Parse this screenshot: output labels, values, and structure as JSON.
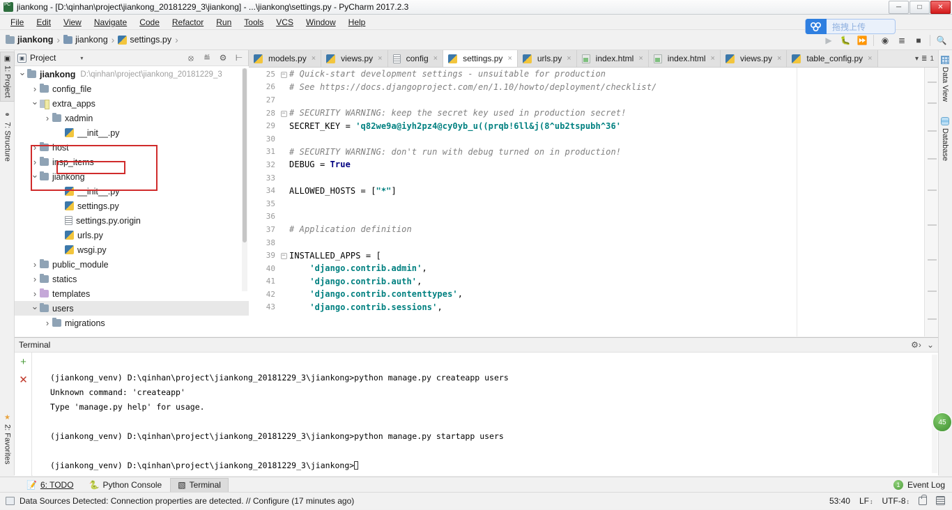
{
  "window": {
    "title": "jiankong - [D:\\qinhan\\project\\jiankong_20181229_3\\jiankong] - ...\\jiankong\\settings.py - PyCharm 2017.2.3",
    "minimize": "─",
    "maximize": "□",
    "close": "✕",
    "app_icon": "pycharm-icon"
  },
  "menu": {
    "items": [
      "File",
      "Edit",
      "View",
      "Navigate",
      "Code",
      "Refactor",
      "Run",
      "Tools",
      "VCS",
      "Window",
      "Help"
    ]
  },
  "breadcrumb": {
    "items": [
      {
        "label": "jiankong",
        "icon": "folder-icon",
        "bold": true
      },
      {
        "label": "jiankong",
        "icon": "folder-icon",
        "bold": false
      },
      {
        "label": "settings.py",
        "icon": "python-file-icon",
        "bold": false
      }
    ],
    "separator": "›"
  },
  "upload_pill": {
    "label": "拖拽上传",
    "icon": "baidu-cloud-icon"
  },
  "toolbar": {
    "buttons": [
      "run-icon",
      "debug-icon",
      "coverage-icon",
      "profile-icon",
      "run-with-console-icon",
      "stop-icon",
      "search-icon"
    ]
  },
  "left_strip": {
    "tabs": [
      {
        "label": "1: Project",
        "icon": "project-icon",
        "selected": true
      },
      {
        "label": "7: Structure",
        "icon": "structure-icon",
        "selected": false
      },
      {
        "label": "2: Favorites",
        "icon": "favorites-star-icon",
        "selected": false
      }
    ]
  },
  "right_strip": {
    "tabs": [
      {
        "label": "Data View",
        "icon": "data-view-grid-icon"
      },
      {
        "label": "Database",
        "icon": "database-icon"
      }
    ]
  },
  "project_panel": {
    "title": "Project",
    "caret": "▾",
    "header_buttons": [
      "collapse-all-icon",
      "expand-all-icon",
      "settings-gear-icon",
      "hide-icon"
    ],
    "tree": [
      {
        "label": "jiankong",
        "path": "D:\\qinhan\\project\\jiankong_20181229_3",
        "indent": 0,
        "arrow": "open",
        "icon": "folder-icon",
        "bold": true,
        "selected": false
      },
      {
        "label": "config_file",
        "path": "",
        "indent": 1,
        "arrow": "closed",
        "icon": "folder-icon",
        "bold": false,
        "selected": false
      },
      {
        "label": "extra_apps",
        "path": "",
        "indent": 1,
        "arrow": "open",
        "icon": "module-folder-icon",
        "bold": false,
        "selected": false
      },
      {
        "label": "xadmin",
        "path": "",
        "indent": 2,
        "arrow": "closed",
        "icon": "folder-icon",
        "bold": false,
        "selected": false
      },
      {
        "label": "__init__.py",
        "path": "",
        "indent": 3,
        "arrow": "none",
        "icon": "python-file-icon",
        "bold": false,
        "selected": false
      },
      {
        "label": "host",
        "path": "",
        "indent": 1,
        "arrow": "closed",
        "icon": "folder-icon",
        "bold": false,
        "selected": false
      },
      {
        "label": "insp_items",
        "path": "",
        "indent": 1,
        "arrow": "closed",
        "icon": "folder-icon",
        "bold": false,
        "selected": false
      },
      {
        "label": "jiankong",
        "path": "",
        "indent": 1,
        "arrow": "open",
        "icon": "folder-icon",
        "bold": false,
        "selected": false
      },
      {
        "label": "__init__.py",
        "path": "",
        "indent": 3,
        "arrow": "none",
        "icon": "python-file-icon",
        "bold": false,
        "selected": false
      },
      {
        "label": "settings.py",
        "path": "",
        "indent": 3,
        "arrow": "none",
        "icon": "python-file-icon",
        "bold": false,
        "selected": false
      },
      {
        "label": "settings.py.origin",
        "path": "",
        "indent": 3,
        "arrow": "none",
        "icon": "text-file-icon",
        "bold": false,
        "selected": false
      },
      {
        "label": "urls.py",
        "path": "",
        "indent": 3,
        "arrow": "none",
        "icon": "python-file-icon",
        "bold": false,
        "selected": false
      },
      {
        "label": "wsgi.py",
        "path": "",
        "indent": 3,
        "arrow": "none",
        "icon": "python-file-icon",
        "bold": false,
        "selected": false
      },
      {
        "label": "public_module",
        "path": "",
        "indent": 1,
        "arrow": "closed",
        "icon": "folder-icon",
        "bold": false,
        "selected": false
      },
      {
        "label": "statics",
        "path": "",
        "indent": 1,
        "arrow": "closed",
        "icon": "folder-icon",
        "bold": false,
        "selected": false
      },
      {
        "label": "templates",
        "path": "",
        "indent": 1,
        "arrow": "closed",
        "icon": "templates-folder-icon",
        "bold": false,
        "selected": false
      },
      {
        "label": "users",
        "path": "",
        "indent": 1,
        "arrow": "open",
        "icon": "folder-icon",
        "bold": false,
        "selected": true
      },
      {
        "label": "migrations",
        "path": "",
        "indent": 2,
        "arrow": "closed",
        "icon": "folder-icon",
        "bold": false,
        "selected": false
      }
    ],
    "highlight_color": "#d02b2b"
  },
  "editor": {
    "tabs": [
      {
        "label": "models.py",
        "icon": "python-file-icon",
        "active": false
      },
      {
        "label": "views.py",
        "icon": "python-file-icon",
        "active": false
      },
      {
        "label": "config",
        "icon": "text-file-icon",
        "active": false
      },
      {
        "label": "settings.py",
        "icon": "python-file-icon",
        "active": true
      },
      {
        "label": "urls.py",
        "icon": "python-file-icon",
        "active": false
      },
      {
        "label": "index.html",
        "icon": "html-file-icon",
        "active": false
      },
      {
        "label": "index.html",
        "icon": "html-file-icon",
        "active": false
      },
      {
        "label": "views.py",
        "icon": "python-file-icon",
        "active": false
      },
      {
        "label": "table_config.py",
        "icon": "python-file-icon",
        "active": false
      }
    ],
    "tab_close_glyph": "×",
    "tabs_overflow_label": "1",
    "lines": [
      {
        "num": "25",
        "fold": "minus",
        "tokens": [
          {
            "t": "# Quick-start development settings - unsuitable for production",
            "c": "c-comment"
          }
        ]
      },
      {
        "num": "26",
        "fold": "",
        "tokens": [
          {
            "t": "# See https://docs.djangoproject.com/en/1.10/howto/deployment/checklist/",
            "c": "c-comment"
          }
        ]
      },
      {
        "num": "27",
        "fold": "",
        "tokens": []
      },
      {
        "num": "28",
        "fold": "minus",
        "tokens": [
          {
            "t": "# SECURITY WARNING: keep the secret key used in production secret!",
            "c": "c-comment"
          }
        ]
      },
      {
        "num": "29",
        "fold": "",
        "tokens": [
          {
            "t": "SECRET_KEY = ",
            "c": ""
          },
          {
            "t": "'q82we9a@iyh2pz4@cy0yb_u((prqb!6ll&j(8^ub2tspubh^36'",
            "c": "c-str"
          }
        ]
      },
      {
        "num": "30",
        "fold": "",
        "tokens": []
      },
      {
        "num": "31",
        "fold": "",
        "tokens": [
          {
            "t": "# SECURITY WARNING: don't run with debug turned on in production!",
            "c": "c-comment"
          }
        ]
      },
      {
        "num": "32",
        "fold": "",
        "tokens": [
          {
            "t": "DEBUG = ",
            "c": ""
          },
          {
            "t": "True",
            "c": "c-kw"
          }
        ]
      },
      {
        "num": "33",
        "fold": "",
        "tokens": []
      },
      {
        "num": "34",
        "fold": "",
        "tokens": [
          {
            "t": "ALLOWED_HOSTS = [",
            "c": ""
          },
          {
            "t": "\"*\"",
            "c": "c-str"
          },
          {
            "t": "]",
            "c": ""
          }
        ]
      },
      {
        "num": "35",
        "fold": "",
        "tokens": []
      },
      {
        "num": "36",
        "fold": "",
        "tokens": []
      },
      {
        "num": "37",
        "fold": "",
        "tokens": [
          {
            "t": "# Application definition",
            "c": "c-comment"
          }
        ]
      },
      {
        "num": "38",
        "fold": "",
        "tokens": []
      },
      {
        "num": "39",
        "fold": "minus",
        "tokens": [
          {
            "t": "INSTALLED_APPS = [",
            "c": ""
          }
        ]
      },
      {
        "num": "40",
        "fold": "",
        "tokens": [
          {
            "t": "    ",
            "c": ""
          },
          {
            "t": "'django.contrib.admin'",
            "c": "c-str"
          },
          {
            "t": ",",
            "c": ""
          }
        ]
      },
      {
        "num": "41",
        "fold": "",
        "tokens": [
          {
            "t": "    ",
            "c": ""
          },
          {
            "t": "'django.contrib.auth'",
            "c": "c-str"
          },
          {
            "t": ",",
            "c": ""
          }
        ]
      },
      {
        "num": "42",
        "fold": "",
        "tokens": [
          {
            "t": "    ",
            "c": ""
          },
          {
            "t": "'django.contrib.contenttypes'",
            "c": "c-str"
          },
          {
            "t": ",",
            "c": ""
          }
        ]
      },
      {
        "num": "43",
        "fold": "",
        "tokens": [
          {
            "t": "    ",
            "c": ""
          },
          {
            "t": "'django.contrib.sessions'",
            "c": "c-str"
          },
          {
            "t": ",",
            "c": ""
          }
        ]
      }
    ]
  },
  "terminal": {
    "title": "Terminal",
    "add_button": "+",
    "close_button": "✕",
    "settings_icon": "gear-icon",
    "hide_icon": "hide-icon",
    "lines": [
      "",
      "(jiankong_venv) D:\\qinhan\\project\\jiankong_20181229_3\\jiankong>python manage.py createapp users",
      "Unknown command: 'createapp'",
      "Type 'manage.py help' for usage.",
      "",
      "(jiankong_venv) D:\\qinhan\\project\\jiankong_20181229_3\\jiankong>python manage.py startapp users",
      "",
      "(jiankong_venv) D:\\qinhan\\project\\jiankong_20181229_3\\jiankong>"
    ]
  },
  "bottom_tabs": {
    "items": [
      {
        "label": "6: TODO",
        "icon": "todo-icon",
        "active": false
      },
      {
        "label": "Python Console",
        "icon": "python-console-icon",
        "active": false
      },
      {
        "label": "Terminal",
        "icon": "terminal-icon",
        "active": true
      }
    ],
    "event_log": {
      "label": "Event Log",
      "count": "1"
    }
  },
  "status_bar": {
    "message": "Data Sources Detected: Connection properties are detected. // Configure (17 minutes ago)",
    "icon": "database-detected-icon",
    "caret_position": "53:40",
    "line_separator": "LF",
    "encoding": "UTF-8",
    "lock_icon": "lock-icon",
    "tray_icon": "event-tray-icon"
  },
  "float_badge": {
    "label": "45"
  }
}
